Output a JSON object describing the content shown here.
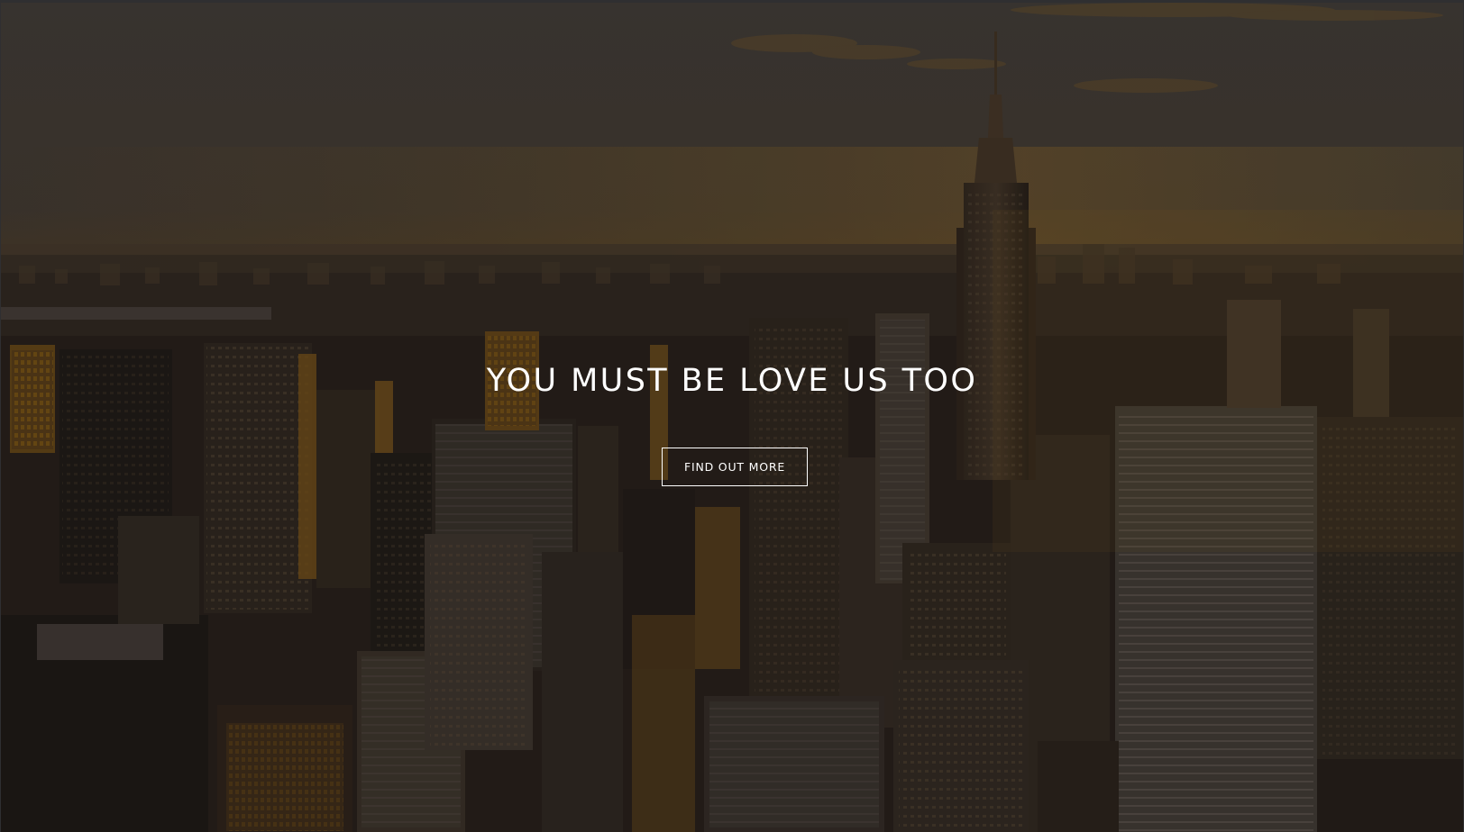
{
  "hero": {
    "title": "YOU MUST BE LOVE US TOO",
    "cta_label": "FIND OUT MORE",
    "background": "city-skyline-sunset-image"
  },
  "colors": {
    "text": "#ffffff",
    "button_border": "#ffffff",
    "page_background": "#2f2f31",
    "accent_glow": "#c9912c"
  }
}
